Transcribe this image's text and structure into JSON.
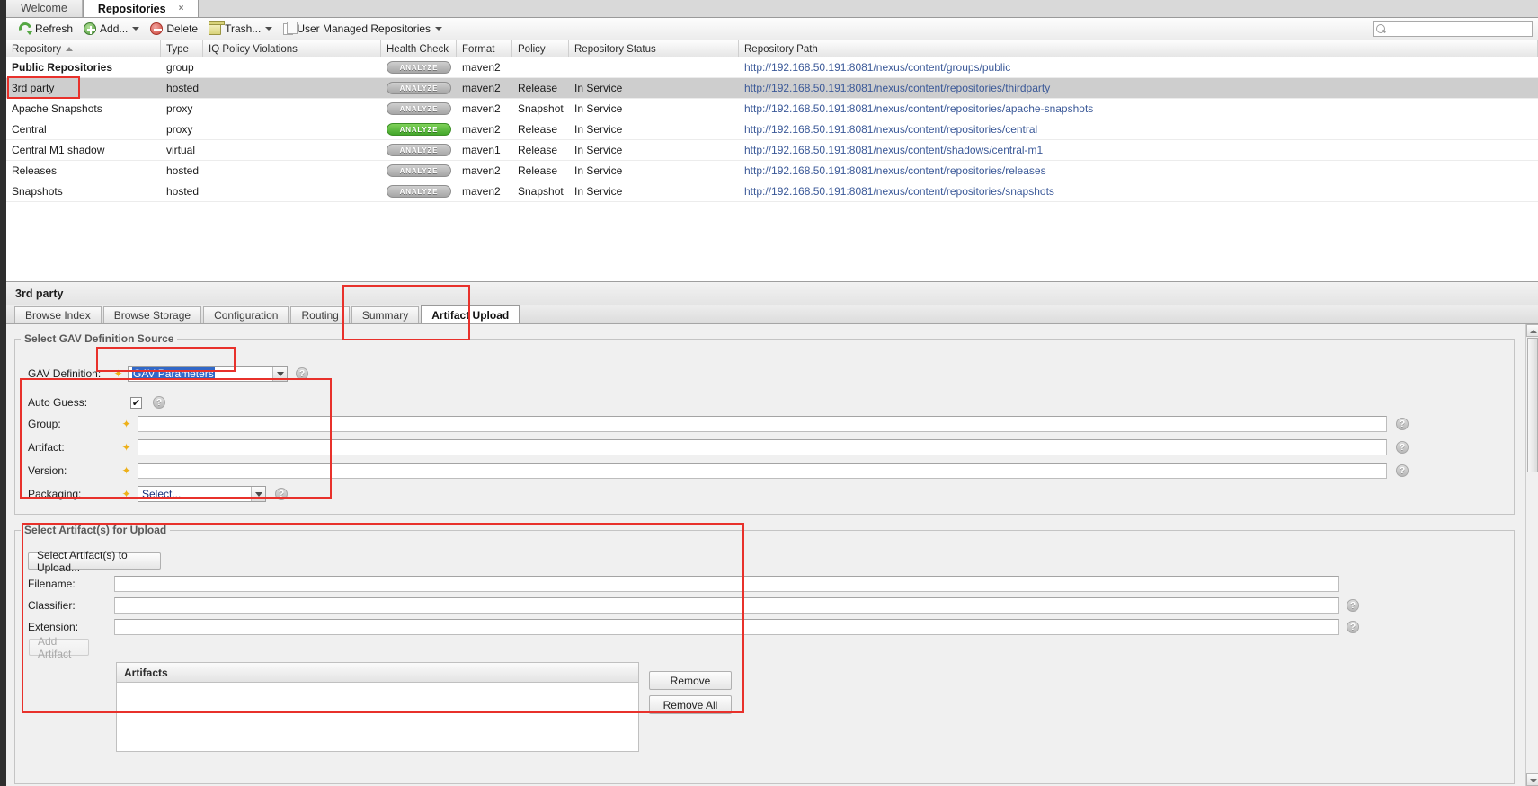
{
  "window": {
    "tabs": [
      {
        "label": "Welcome",
        "active": false,
        "closable": false
      },
      {
        "label": "Repositories",
        "active": true,
        "closable": true,
        "close": "×"
      }
    ]
  },
  "toolbar": {
    "refresh": "Refresh",
    "add": "Add...",
    "delete": "Delete",
    "trash": "Trash...",
    "user_managed": "User Managed Repositories",
    "search_placeholder": ""
  },
  "grid": {
    "columns": [
      {
        "label": "Repository",
        "sorted": "asc"
      },
      {
        "label": "Type"
      },
      {
        "label": "IQ Policy Violations"
      },
      {
        "label": "Health Check"
      },
      {
        "label": "Format"
      },
      {
        "label": "Policy"
      },
      {
        "label": "Repository Status"
      },
      {
        "label": "Repository Path"
      }
    ],
    "analyze_label": "ANALYZE",
    "rows": [
      {
        "repository": "Public Repositories",
        "type": "group",
        "violations": "",
        "health": "analyze-grey",
        "format": "maven2",
        "policy": "",
        "status": "",
        "path": "http://192.168.50.191:8081/nexus/content/groups/public",
        "bold": true,
        "selected": false
      },
      {
        "repository": "3rd party",
        "type": "hosted",
        "violations": "",
        "health": "analyze-grey",
        "format": "maven2",
        "policy": "Release",
        "status": "In Service",
        "path": "http://192.168.50.191:8081/nexus/content/repositories/thirdparty",
        "bold": false,
        "selected": true
      },
      {
        "repository": "Apache Snapshots",
        "type": "proxy",
        "violations": "",
        "health": "analyze-grey",
        "format": "maven2",
        "policy": "Snapshot",
        "status": "In Service",
        "path": "http://192.168.50.191:8081/nexus/content/repositories/apache-snapshots",
        "bold": false,
        "selected": false
      },
      {
        "repository": "Central",
        "type": "proxy",
        "violations": "",
        "health": "analyze-green",
        "format": "maven2",
        "policy": "Release",
        "status": "In Service",
        "path": "http://192.168.50.191:8081/nexus/content/repositories/central",
        "bold": false,
        "selected": false
      },
      {
        "repository": "Central M1 shadow",
        "type": "virtual",
        "violations": "",
        "health": "analyze-grey",
        "format": "maven1",
        "policy": "Release",
        "status": "In Service",
        "path": "http://192.168.50.191:8081/nexus/content/shadows/central-m1",
        "bold": false,
        "selected": false
      },
      {
        "repository": "Releases",
        "type": "hosted",
        "violations": "",
        "health": "analyze-grey",
        "format": "maven2",
        "policy": "Release",
        "status": "In Service",
        "path": "http://192.168.50.191:8081/nexus/content/repositories/releases",
        "bold": false,
        "selected": false
      },
      {
        "repository": "Snapshots",
        "type": "hosted",
        "violations": "",
        "health": "analyze-grey",
        "format": "maven2",
        "policy": "Snapshot",
        "status": "In Service",
        "path": "http://192.168.50.191:8081/nexus/content/repositories/snapshots",
        "bold": false,
        "selected": false
      }
    ]
  },
  "detail": {
    "title": "3rd party",
    "tabs": [
      {
        "label": "Browse Index",
        "active": false
      },
      {
        "label": "Browse Storage",
        "active": false
      },
      {
        "label": "Configuration",
        "active": false
      },
      {
        "label": "Routing",
        "active": false
      },
      {
        "label": "Summary",
        "active": false
      },
      {
        "label": "Artifact Upload",
        "active": true
      }
    ]
  },
  "gav_section": {
    "legend": "Select GAV Definition Source",
    "gav_definition_label": "GAV Definition:",
    "gav_definition_value": "GAV Parameters",
    "help": "?",
    "auto_guess_label": "Auto Guess:",
    "auto_guess_checked": "✔",
    "group_label": "Group:",
    "group_value": "",
    "artifact_label": "Artifact:",
    "artifact_value": "",
    "version_label": "Version:",
    "version_value": "",
    "packaging_label": "Packaging:",
    "packaging_value": "Select..."
  },
  "upload_section": {
    "legend": "Select Artifact(s) for Upload",
    "select_button": "Select Artifact(s) to Upload...",
    "filename_label": "Filename:",
    "filename_value": "",
    "classifier_label": "Classifier:",
    "classifier_value": "",
    "extension_label": "Extension:",
    "extension_value": "",
    "add_artifact_button": "Add Artifact",
    "artifacts_header": "Artifacts",
    "remove_button": "Remove",
    "remove_all_button": "Remove All",
    "help": "?"
  },
  "colors": {
    "highlight": "#e8312b",
    "selected_row": "#cecece",
    "link": "#3b5998",
    "analyze_green": "#43a62a",
    "required_star": "#edb019"
  }
}
